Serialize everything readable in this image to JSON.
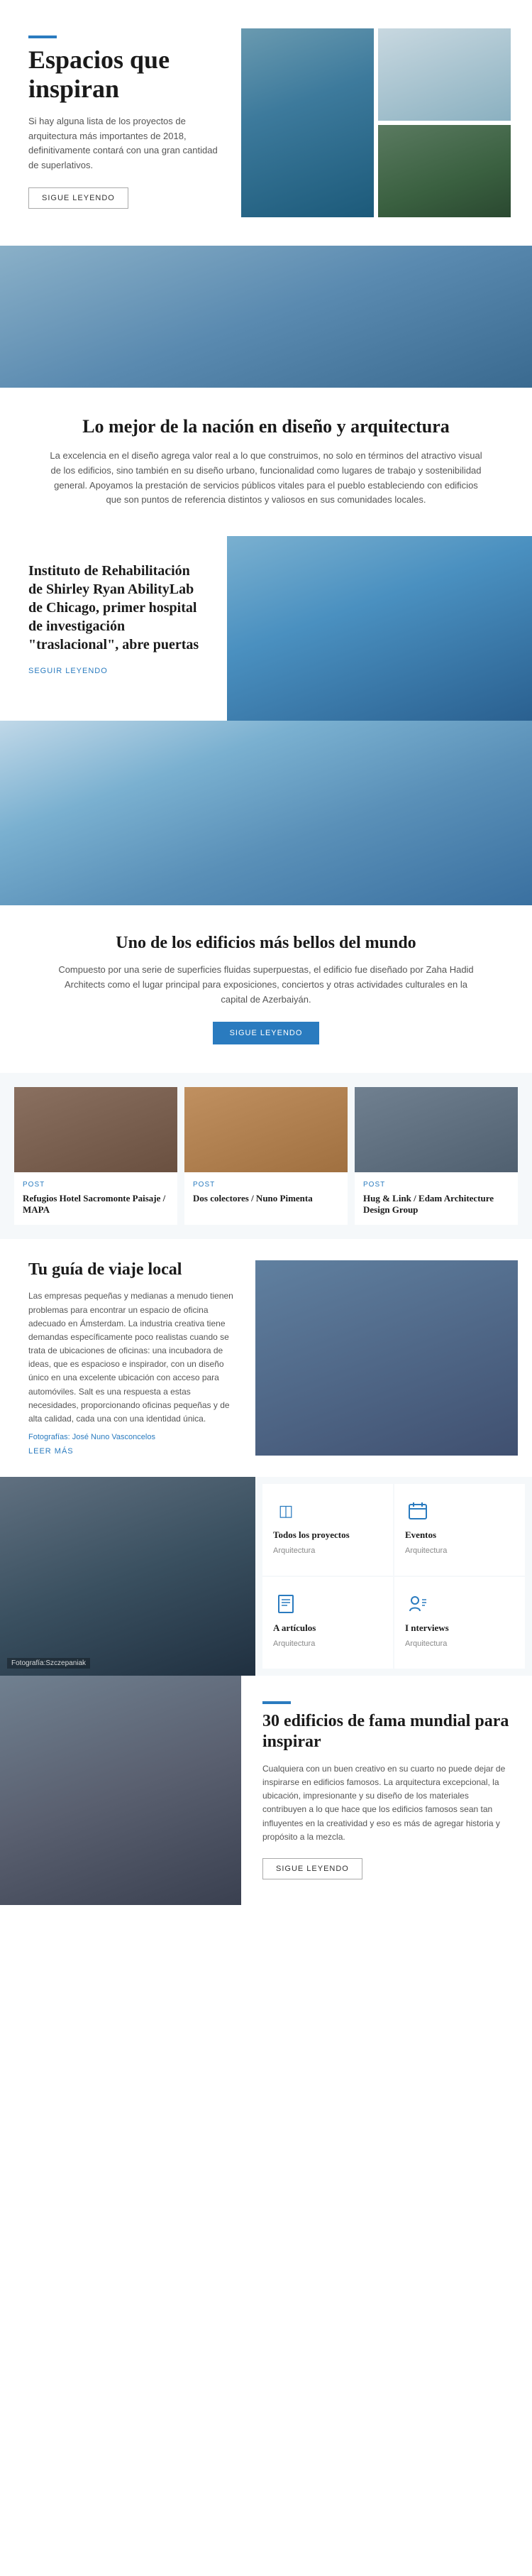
{
  "hero": {
    "title": "Espacios que inspiran",
    "description": "Si hay alguna lista de los proyectos de arquitectura más importantes de 2018, definitivamente contará con una gran cantidad de superlativos.",
    "button": "SIGUE LEYENDO"
  },
  "nation": {
    "title": "Lo mejor de la nación en diseño y arquitectura",
    "description": "La excelencia en el diseño agrega valor real a lo que construimos, no solo en términos del atractivo visual de los edificios, sino también en su diseño urbano, funcionalidad como lugares de trabajo y sostenibilidad general. Apoyamos la prestación de servicios públicos vitales para el pueblo estableciendo con edificios que son puntos de referencia distintos y valiosos en sus comunidades locales."
  },
  "hospital": {
    "title": "Instituto de Rehabilitación de Shirley Ryan AbilityLab de Chicago, primer hospital de investigación \"traslacional\", abre puertas",
    "read_more": "SEGUIR LEYENDO"
  },
  "beautiful": {
    "title": "Uno de los edificios más bellos del mundo",
    "description": "Compuesto por una serie de superficies fluidas superpuestas, el edificio fue diseñado por Zaha Hadid Architects como el lugar principal para exposiciones, conciertos y otras actividades culturales en la capital de Azerbaiyán.",
    "button": "SIGUE LEYENDO"
  },
  "cards": [
    {
      "label": "Post",
      "title": "Refugios Hotel Sacromonte Paisaje / MAPA",
      "img_class": "img-cabin"
    },
    {
      "label": "Post",
      "title": "Dos colectores / Nuno Pimenta",
      "img_class": "img-wood"
    },
    {
      "label": "Post",
      "title": "Hug & Link / Edam Architecture Design Group",
      "img_class": "img-hug"
    }
  ],
  "travel": {
    "title": "Tu guía de viaje local",
    "description": "Las empresas pequeñas y medianas a menudo tienen problemas para encontrar un espacio de oficina adecuado en Ámsterdam. La industria creativa tiene demandas específicamente poco realistas cuando se trata de ubicaciones de oficinas: una incubadora de ideas, que es espacioso e inspirador, con un diseño único en una excelente ubicación con acceso para automóviles. Salt es una respuesta a estas necesidades, proporcionando oficinas pequeñas y de alta calidad, cada una con una identidad única.",
    "photo_label": "Fotografías:",
    "photo_author": "José Nuno Vasconcelos",
    "read_more": "LEER MÁS"
  },
  "icon_cards": [
    {
      "icon": "◫",
      "title": "Todos los proyectos",
      "sub": "Arquitectura"
    },
    {
      "icon": "📅",
      "title": "Eventos",
      "sub": "Arquitectura"
    },
    {
      "icon": "✏",
      "title": "A artículos",
      "sub": "Arquitectura"
    },
    {
      "icon": "🎤",
      "title": "I nterviews",
      "sub": "Arquitectura"
    }
  ],
  "buildings30": {
    "title": "30 edificios de fama mundial para inspirar",
    "description": "Cualquiera con un buen creativo en su cuarto no puede dejar de inspirarse en edificios famosos. La arquitectura excepcional, la ubicación, impresionante y su diseño de los materiales contribuyen a lo que hace que los edificios famosos sean tan influyentes en la creatividad y eso es más de agregar historia y propósito a la mezcla.",
    "button": "SIGUE LEYENDO",
    "left_caption": "Fotografía:Szczepaniak"
  }
}
